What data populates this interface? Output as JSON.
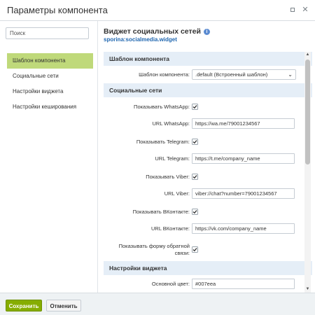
{
  "window": {
    "title": "Параметры компонента",
    "expand_icon": "expand-icon",
    "close_icon": "close-icon"
  },
  "sidebar": {
    "search_placeholder": "Поиск",
    "items": [
      {
        "label": "Шаблон компонента",
        "active": true
      },
      {
        "label": "Социальные сети",
        "active": false
      },
      {
        "label": "Настройки виджета",
        "active": false
      },
      {
        "label": "Настройки кеширования",
        "active": false
      }
    ]
  },
  "main": {
    "title": "Виджет социальных сетей",
    "subtitle": "sporina:socialmedia.widget",
    "info_icon": "i"
  },
  "sections": {
    "template": {
      "heading": "Шаблон компонента",
      "template_label": "Шаблон компонента:",
      "template_value": ".default (Встроенный шаблон)"
    },
    "social": {
      "heading": "Социальные сети",
      "show_whatsapp_label": "Показывать WhatsApp:",
      "show_whatsapp_checked": true,
      "url_whatsapp_label": "URL WhatsApp:",
      "url_whatsapp_value": "https://wa.me/79001234567",
      "show_telegram_label": "Показывать Telegram:",
      "show_telegram_checked": true,
      "url_telegram_label": "URL Telegram:",
      "url_telegram_value": "https://t.me/company_name",
      "show_viber_label": "Показывать Viber:",
      "show_viber_checked": true,
      "url_viber_label": "URL Viber:",
      "url_viber_value": "viber://chat?number=79001234567",
      "show_vk_label": "Показывать ВКонтакте:",
      "show_vk_checked": true,
      "url_vk_label": "URL ВКонтакте:",
      "url_vk_value": "https://vk.com/company_name",
      "show_feedback_label": "Показывать форму обратной связи:",
      "show_feedback_checked": true
    },
    "widget": {
      "heading": "Настройки виджета",
      "main_color_label": "Основной цвет:",
      "main_color_value": "#007eea"
    }
  },
  "footer": {
    "save_label": "Сохранить",
    "cancel_label": "Отменить"
  },
  "colors": {
    "accent_green": "#86ad00",
    "active_nav": "#bfd97a",
    "section_header": "#e5eef7",
    "link_blue": "#2067b0"
  }
}
